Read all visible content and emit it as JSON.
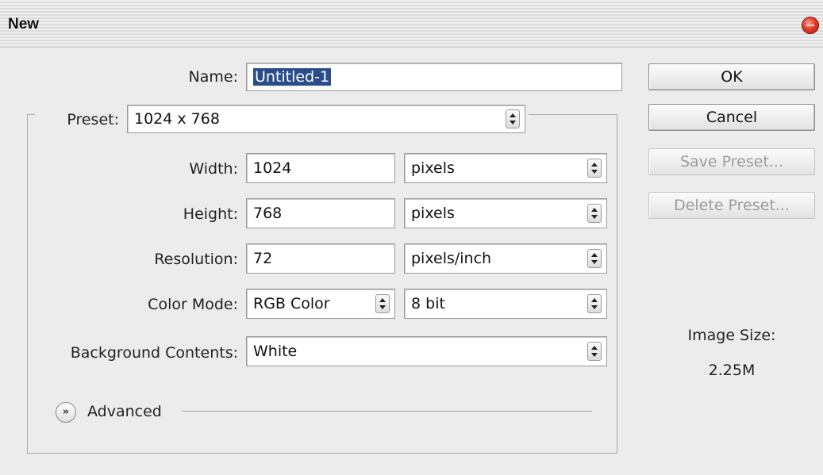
{
  "window": {
    "title": "New"
  },
  "name": {
    "label": "Name:",
    "value": "Untitled-1"
  },
  "preset": {
    "label": "Preset:",
    "value": "1024 x 768"
  },
  "width": {
    "label": "Width:",
    "value": "1024",
    "unit": "pixels"
  },
  "height": {
    "label": "Height:",
    "value": "768",
    "unit": "pixels"
  },
  "resolution": {
    "label": "Resolution:",
    "value": "72",
    "unit": "pixels/inch"
  },
  "color_mode": {
    "label": "Color Mode:",
    "value": "RGB Color",
    "depth": "8 bit"
  },
  "background": {
    "label": "Background Contents:",
    "value": "White"
  },
  "advanced": {
    "label": "Advanced"
  },
  "buttons": {
    "ok": "OK",
    "cancel": "Cancel",
    "save_preset": "Save Preset...",
    "delete_preset": "Delete Preset..."
  },
  "image_size": {
    "label": "Image Size:",
    "value": "2.25M"
  },
  "colors": {
    "selection": "#2a4d8a",
    "close": "#e23b2a"
  },
  "icons": {
    "close": "close-icon",
    "advanced": "chevron-double-down-icon",
    "stepper": "updown-arrows-icon"
  }
}
